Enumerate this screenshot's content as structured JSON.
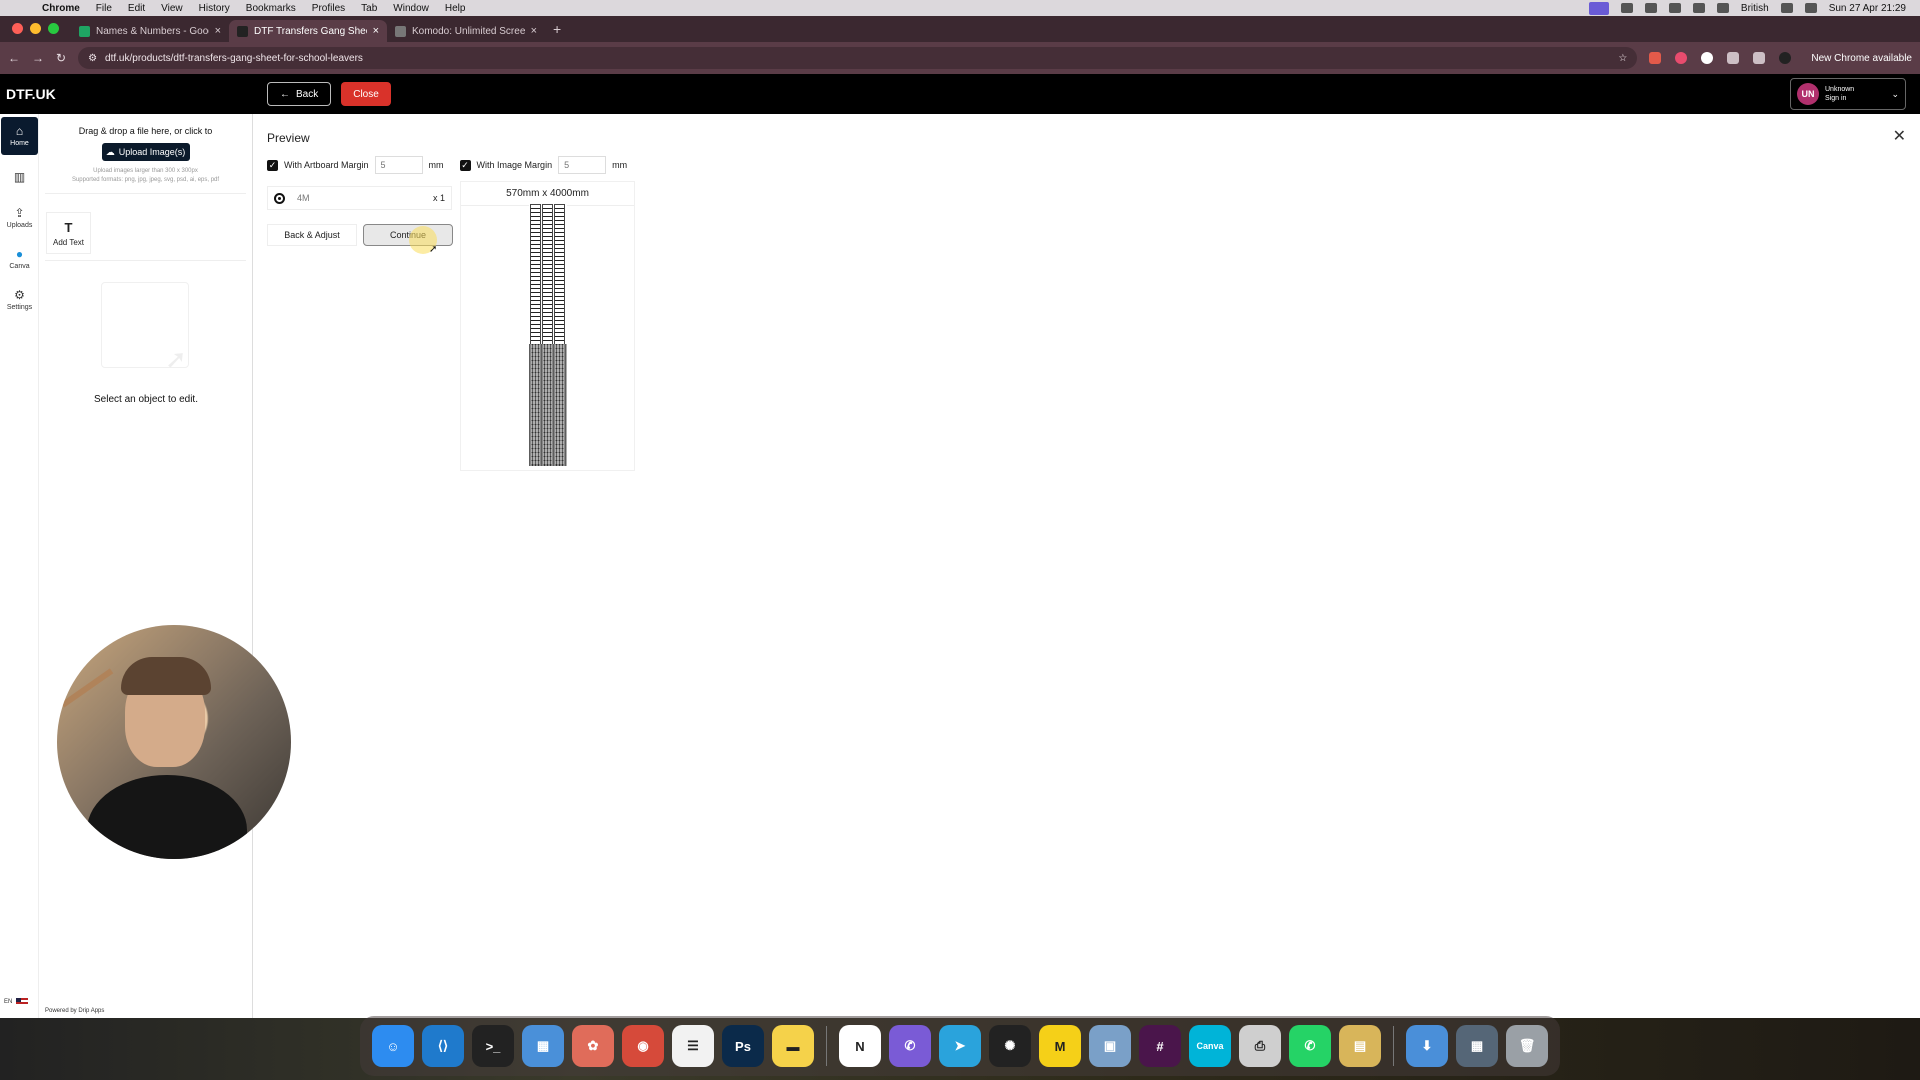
{
  "menubar": {
    "app": "Chrome",
    "items": [
      "File",
      "Edit",
      "View",
      "History",
      "Bookmarks",
      "Profiles",
      "Tab",
      "Window",
      "Help"
    ],
    "input_source": "British",
    "datetime": "Sun 27 Apr 21:29"
  },
  "tabs": [
    {
      "title": "Names & Numbers - Google S",
      "favicon_color": "#1fa463"
    },
    {
      "title": "DTF Transfers Gang Sheet fo",
      "favicon_color": "#222222"
    },
    {
      "title": "Komodo: Unlimited Screen Re",
      "favicon_color": "#777777"
    }
  ],
  "address": {
    "url": "dtf.uk/products/dtf-transfers-gang-sheet-for-school-leavers",
    "update_label": "New Chrome available"
  },
  "header": {
    "logo": "DTF.UK",
    "back_label": "Back",
    "close_label": "Close",
    "user_initials": "UN",
    "user_name": "Unknown",
    "user_action": "Sign in"
  },
  "rail": [
    {
      "label": "Home",
      "icon": "home-icon"
    },
    {
      "label": "",
      "icon": "product-icon"
    },
    {
      "label": "Uploads",
      "icon": "upload-icon"
    },
    {
      "label": "Canva",
      "icon": "canva-icon"
    },
    {
      "label": "Settings",
      "icon": "gear-icon"
    }
  ],
  "panel": {
    "drop_text": "Drag & drop a file here, or click to",
    "upload_label": "Upload Image(s)",
    "hint_1": "Upload images larger than 300 x 300px",
    "hint_2": "Supported formats: png, jpg, jpeg, svg, psd, ai, eps, pdf",
    "add_text_label": "Add Text",
    "select_text": "Select an object to edit.",
    "powered_by": "Powered by Drip Apps",
    "lang": "EN"
  },
  "preview": {
    "title": "Preview",
    "artboard_margin_label": "With Artboard Margin",
    "artboard_margin_value": "5",
    "image_margin_label": "With Image Margin",
    "image_margin_value": "5",
    "unit": "mm",
    "size_name": "4M",
    "size_qty": "x 1",
    "back_adjust_label": "Back & Adjust",
    "continue_label": "Continue",
    "sheet_dimensions": "570mm x 4000mm"
  },
  "dock": [
    {
      "name": "finder-icon",
      "color": "#2d8cf0",
      "glyph": "☺"
    },
    {
      "name": "vscode-icon",
      "color": "#1f7acc",
      "glyph": "⟨⟩"
    },
    {
      "name": "terminal-icon",
      "color": "#222222",
      "glyph": ">_"
    },
    {
      "name": "calculator-icon",
      "color": "#4a90d9",
      "glyph": "▦"
    },
    {
      "name": "photos-icon",
      "color": "#e06c5a",
      "glyph": "✿"
    },
    {
      "name": "chrome-icon",
      "color": "#d64a3a",
      "glyph": "◉"
    },
    {
      "name": "reminders-icon",
      "color": "#f2f2f2",
      "glyph": "☰"
    },
    {
      "name": "photoshop-icon",
      "color": "#0b2a4a",
      "glyph": "Ps"
    },
    {
      "name": "notes-icon",
      "color": "#f5d24a",
      "glyph": "▬"
    },
    {
      "name": "notion-icon",
      "color": "#ffffff",
      "glyph": "N"
    },
    {
      "name": "viber-icon",
      "color": "#7a5bd6",
      "glyph": "✆"
    },
    {
      "name": "telegram-icon",
      "color": "#2aa3dc",
      "glyph": "➤"
    },
    {
      "name": "chatgpt-icon",
      "color": "#222222",
      "glyph": "✺"
    },
    {
      "name": "miro-icon",
      "color": "#f5d018",
      "glyph": "M"
    },
    {
      "name": "preview-icon",
      "color": "#7aa0c8",
      "glyph": "▣"
    },
    {
      "name": "slack-icon",
      "color": "#4a154b",
      "glyph": "#"
    },
    {
      "name": "canva-icon",
      "color": "#00b4d8",
      "glyph": "Canva"
    },
    {
      "name": "printer-icon",
      "color": "#cfcfcf",
      "glyph": "⎙"
    },
    {
      "name": "whatsapp-icon",
      "color": "#25d366",
      "glyph": "✆"
    },
    {
      "name": "archive-icon",
      "color": "#d8b55a",
      "glyph": "▤"
    },
    {
      "name": "downloads-icon",
      "color": "#4a8fd9",
      "glyph": "⬇"
    },
    {
      "name": "screenshots-icon",
      "color": "#556677",
      "glyph": "▦"
    },
    {
      "name": "trash-icon",
      "color": "#9aa0a6",
      "glyph": "🗑"
    }
  ]
}
